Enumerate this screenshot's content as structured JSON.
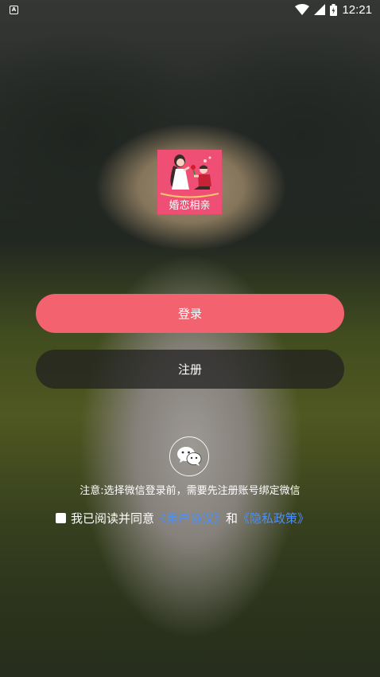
{
  "status_bar": {
    "time": "12:21",
    "app_icon": "a-square-icon",
    "icons": [
      "wifi-icon",
      "signal-icon",
      "battery-icon"
    ]
  },
  "logo": {
    "text": "婚恋相亲",
    "background_color": "#ef4f74"
  },
  "buttons": {
    "login_label": "登录",
    "register_label": "注册",
    "login_color": "#f2636f"
  },
  "wechat": {
    "icon": "wechat-icon",
    "notice": "注意:选择微信登录前，需要先注册账号绑定微信"
  },
  "agreement": {
    "checked": false,
    "prefix": "我已阅读并同意",
    "user_agreement": "《用户协议》",
    "conjunction": "和",
    "privacy_policy": "《隐私政策》",
    "link_color": "#4f8ff0"
  }
}
